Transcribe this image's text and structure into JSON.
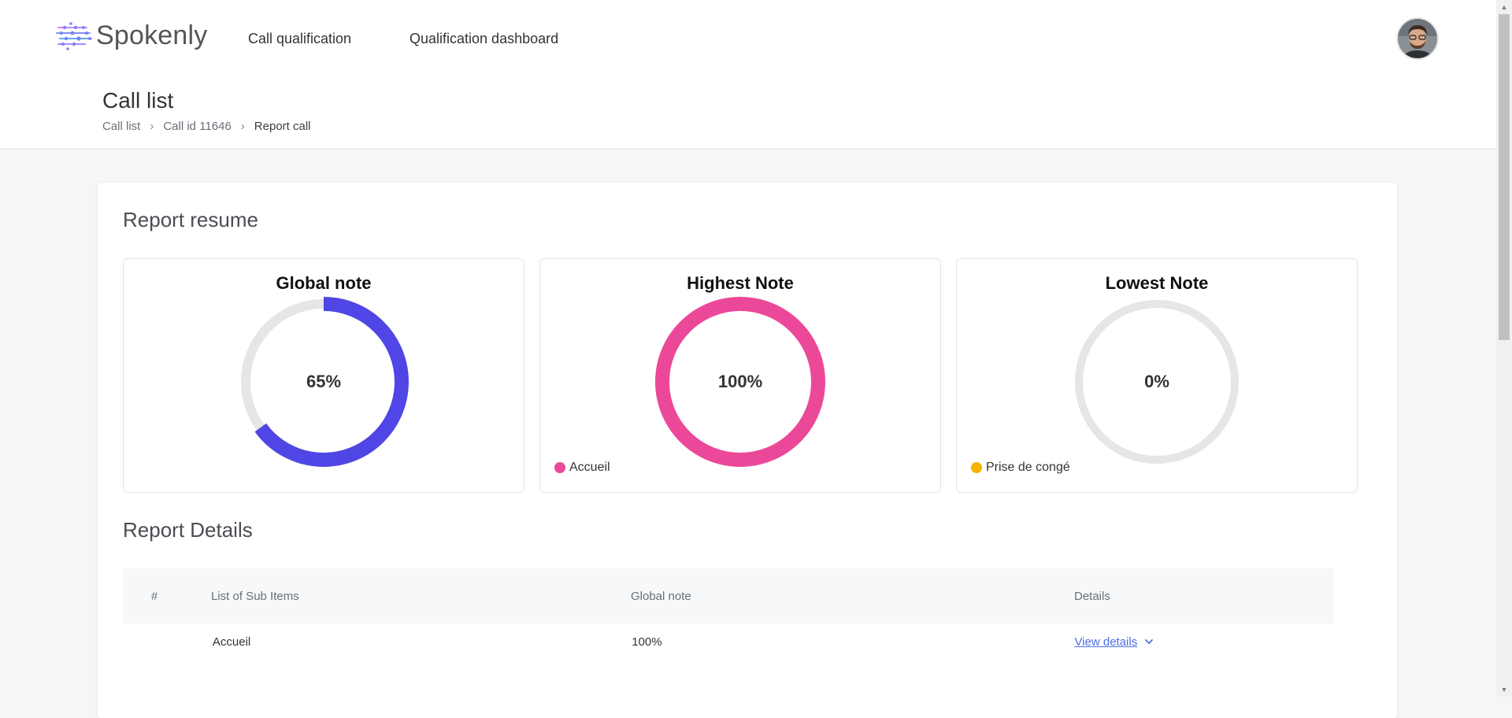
{
  "header": {
    "brand": "Spokenly",
    "nav": [
      "Call qualification",
      "Qualification dashboard"
    ]
  },
  "page": {
    "title": "Call list",
    "breadcrumb": [
      "Call list",
      "Call id 11646",
      "Report call"
    ]
  },
  "report_resume": {
    "title": "Report resume",
    "cards": [
      {
        "title": "Global note",
        "value": 65,
        "value_label": "65%",
        "color": "#4f46e5",
        "legend": null
      },
      {
        "title": "Highest Note",
        "value": 100,
        "value_label": "100%",
        "color": "#ec4899",
        "legend": "Accueil",
        "legend_color": "#ec4899"
      },
      {
        "title": "Lowest Note",
        "value": 0,
        "value_label": "0%",
        "color": "#f5b400",
        "legend": "Prise de congé",
        "legend_color": "#f5b400"
      }
    ],
    "track_color": "#e6e6e6"
  },
  "report_details": {
    "title": "Report Details",
    "columns": [
      "#",
      "List of Sub Items",
      "Global note",
      "Details"
    ],
    "rows": [
      {
        "num": "",
        "name": "Accueil",
        "note": "100%",
        "details": "View details"
      }
    ]
  }
}
